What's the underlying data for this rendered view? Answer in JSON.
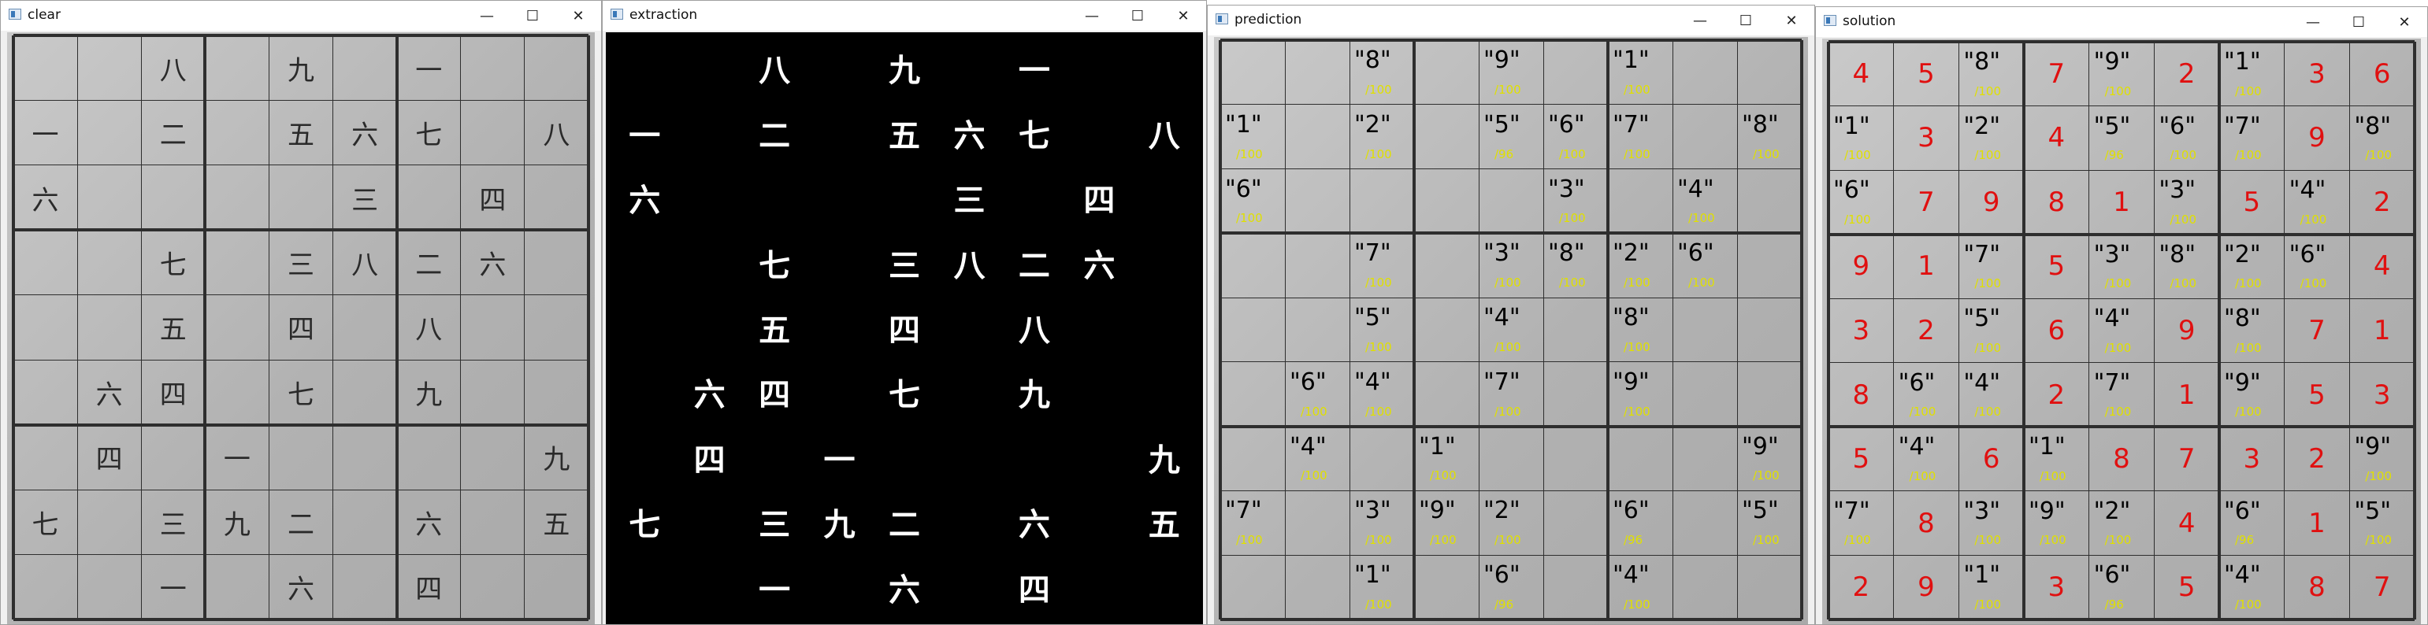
{
  "windows": [
    {
      "id": "clear",
      "title": "clear"
    },
    {
      "id": "extraction",
      "title": "extraction"
    },
    {
      "id": "prediction",
      "title": "prediction"
    },
    {
      "id": "solution",
      "title": "solution"
    }
  ],
  "controls": {
    "minimize": "—",
    "maximize": "☐",
    "close": "✕"
  },
  "icons": {
    "app": "app-window-icon"
  },
  "kanji_grid": [
    [
      "",
      "",
      "八",
      "",
      "九",
      "",
      "一",
      "",
      ""
    ],
    [
      "一",
      "",
      "二",
      "",
      "五",
      "六",
      "七",
      "",
      "八"
    ],
    [
      "六",
      "",
      "",
      "",
      "",
      "三",
      "",
      "四",
      ""
    ],
    [
      "",
      "",
      "七",
      "",
      "三",
      "八",
      "二",
      "六",
      ""
    ],
    [
      "",
      "",
      "五",
      "",
      "四",
      "",
      "八",
      "",
      ""
    ],
    [
      "",
      "六",
      "四",
      "",
      "七",
      "",
      "九",
      "",
      ""
    ],
    [
      "",
      "四",
      "",
      "一",
      "",
      "",
      "",
      "",
      "九"
    ],
    [
      "七",
      "",
      "三",
      "九",
      "二",
      "",
      "六",
      "",
      "五"
    ],
    [
      "",
      "",
      "一",
      "",
      "六",
      "",
      "四",
      "",
      ""
    ]
  ],
  "prediction_grid": [
    [
      "",
      "",
      "\"8\"",
      "",
      "\"9\"",
      "",
      "\"1\"",
      "",
      ""
    ],
    [
      "\"1\"",
      "",
      "\"2\"",
      "",
      "\"5\"",
      "\"6\"",
      "\"7\"",
      "",
      "\"8\""
    ],
    [
      "\"6\"",
      "",
      "",
      "",
      "",
      "\"3\"",
      "",
      "\"4\"",
      ""
    ],
    [
      "",
      "",
      "\"7\"",
      "",
      "\"3\"",
      "\"8\"",
      "\"2\"",
      "\"6\"",
      ""
    ],
    [
      "",
      "",
      "\"5\"",
      "",
      "\"4\"",
      "",
      "\"8\"",
      "",
      ""
    ],
    [
      "",
      "\"6\"",
      "\"4\"",
      "",
      "\"7\"",
      "",
      "\"9\"",
      "",
      ""
    ],
    [
      "",
      "\"4\"",
      "",
      "\"1\"",
      "",
      "",
      "",
      "",
      "\"9\""
    ],
    [
      "\"7\"",
      "",
      "\"3\"",
      "\"9\"",
      "\"2\"",
      "",
      "\"6\"",
      "",
      "\"5\""
    ],
    [
      "",
      "",
      "\"1\"",
      "",
      "\"6\"",
      "",
      "\"4\"",
      "",
      ""
    ]
  ],
  "confidence_grid": [
    [
      "",
      "",
      "/100",
      "",
      "/100",
      "",
      "/100",
      "",
      ""
    ],
    [
      "/100",
      "",
      "/100",
      "",
      "/96",
      "/100",
      "/100",
      "",
      "/100"
    ],
    [
      "/100",
      "",
      "",
      "",
      "",
      "/100",
      "",
      "/100",
      ""
    ],
    [
      "",
      "",
      "/100",
      "",
      "/100",
      "/100",
      "/100",
      "/100",
      ""
    ],
    [
      "",
      "",
      "/100",
      "",
      "/100",
      "",
      "/100",
      "",
      ""
    ],
    [
      "",
      "/100",
      "/100",
      "",
      "/100",
      "",
      "/100",
      "",
      ""
    ],
    [
      "",
      "/100",
      "",
      "/100",
      "",
      "",
      "",
      "",
      "/100"
    ],
    [
      "/100",
      "",
      "/100",
      "/100",
      "/100",
      "",
      "/96",
      "",
      "/100"
    ],
    [
      "",
      "",
      "/100",
      "",
      "/96",
      "",
      "/100",
      "",
      ""
    ]
  ],
  "solution_grid": [
    [
      "4",
      "5",
      "",
      "7",
      "",
      "2",
      "",
      "3",
      "6"
    ],
    [
      "",
      "3",
      "",
      "4",
      "",
      "",
      "",
      "9",
      ""
    ],
    [
      "",
      "7",
      "9",
      "8",
      "1",
      "",
      "5",
      "",
      "2"
    ],
    [
      "9",
      "1",
      "",
      "5",
      "",
      "",
      "",
      "",
      "4"
    ],
    [
      "3",
      "2",
      "",
      "6",
      "",
      "9",
      "",
      "7",
      "1"
    ],
    [
      "8",
      "",
      "",
      "2",
      "",
      "1",
      "",
      "5",
      "3"
    ],
    [
      "5",
      "",
      "6",
      "",
      "8",
      "7",
      "3",
      "2",
      ""
    ],
    [
      "",
      "8",
      "",
      "",
      "",
      "4",
      "",
      "1",
      ""
    ],
    [
      "2",
      "9",
      "",
      "3",
      "",
      "5",
      "",
      "8",
      "7"
    ]
  ],
  "colors": {
    "solution_digit": "#e01010",
    "confidence": "#e0e000",
    "grid_line": "#2e2e2e"
  }
}
